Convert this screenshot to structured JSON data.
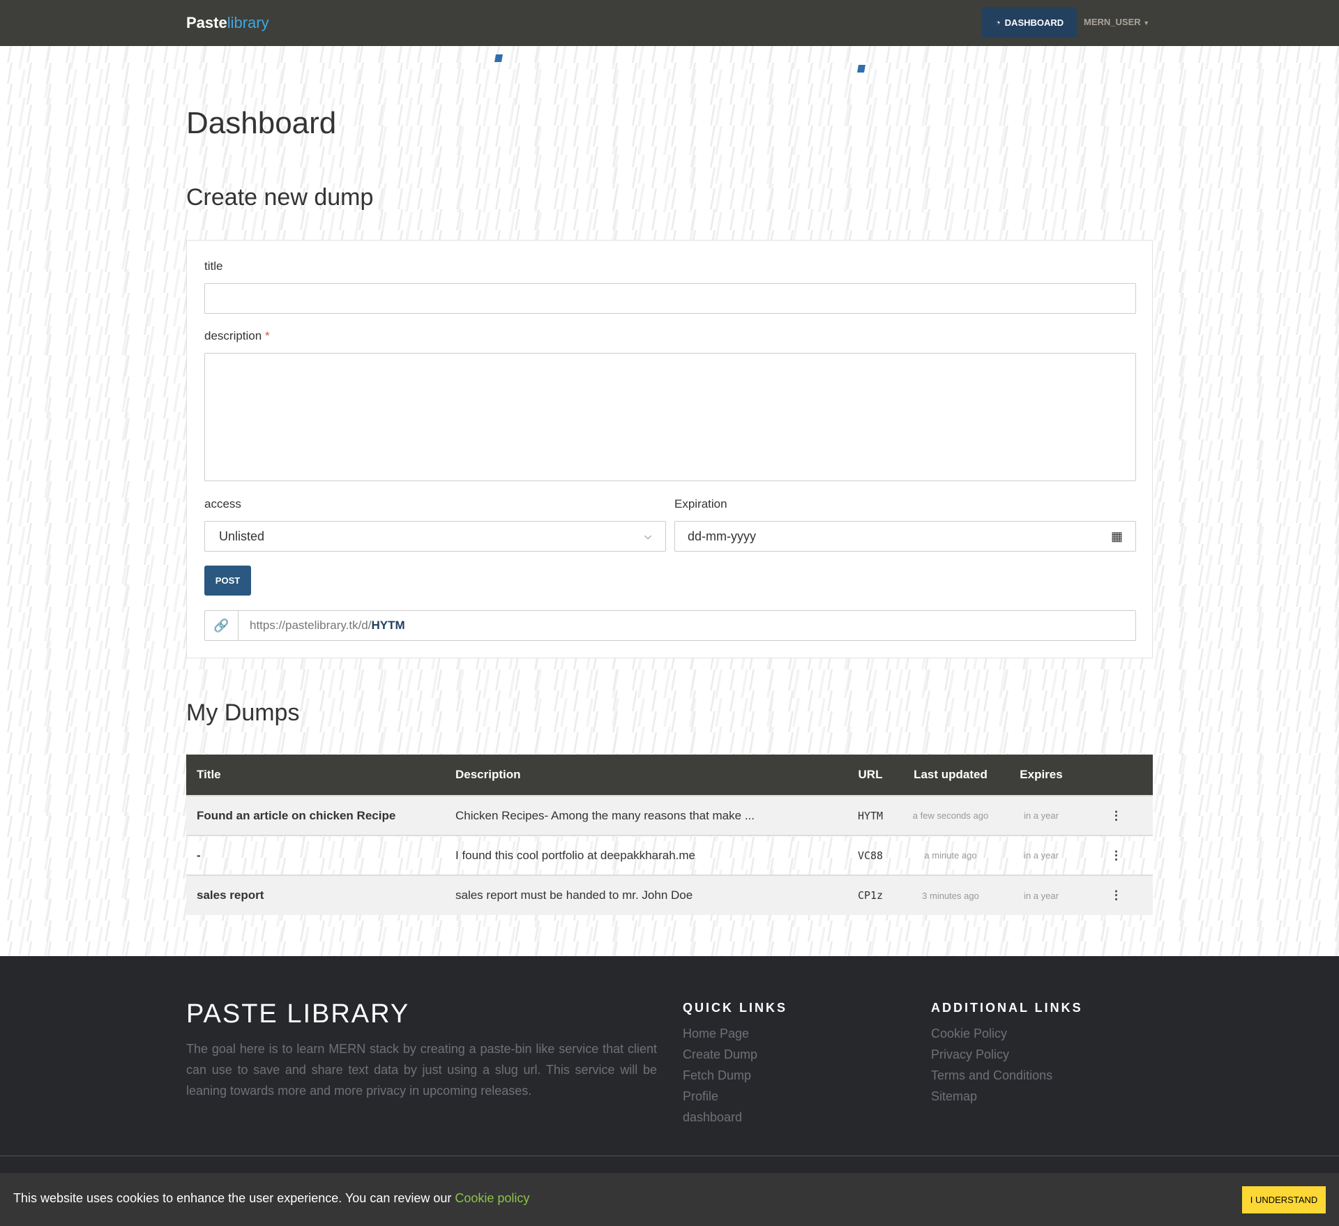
{
  "navbar": {
    "brand_bold": "Paste",
    "brand_light": "library",
    "dashboard": "DASHBOARD",
    "user": "MERN_USER"
  },
  "page": {
    "title": "Dashboard",
    "create_heading": "Create new dump",
    "dumps_heading": "My Dumps"
  },
  "form": {
    "title_label": "title",
    "title_value": "",
    "description_label": "description",
    "required_mark": "*",
    "description_value": "",
    "access_label": "access",
    "access_value": "Unlisted",
    "expiration_label": "Expiration",
    "expiration_placeholder": "dd-mm-yyyy",
    "post_label": "POST",
    "url_prefix": "https://pastelibrary.tk/d/",
    "url_slug": "HYTM"
  },
  "table": {
    "headers": [
      "Title",
      "Description",
      "URL",
      "Last updated",
      "Expires"
    ],
    "rows": [
      {
        "title": "Found an article on chicken Recipe",
        "description": "Chicken Recipes- Among the many reasons that make ...",
        "url": "HYTM",
        "updated": "a few seconds ago",
        "expires": "in a year"
      },
      {
        "title": "-",
        "description": "I found this cool portfolio at deepakkharah.me",
        "url": "VC88",
        "updated": "a minute ago",
        "expires": "in a year"
      },
      {
        "title": "sales report",
        "description": "sales report must be handed to mr. John Doe",
        "url": "CP1z",
        "updated": "3 minutes ago",
        "expires": "in a year"
      }
    ]
  },
  "footer": {
    "title": "PASTE LIBRARY",
    "description": "The goal here is to learn MERN stack by creating a paste-bin like service that client can use to save and share text data by just using a slug url. This service will be leaning towards more and more privacy in upcoming releases.",
    "quick_heading": "QUICK LINKS",
    "quick_links": [
      "Home Page",
      "Create Dump",
      "Fetch Dump",
      "Profile",
      "dashboard"
    ],
    "additional_heading": "ADDITIONAL LINKS",
    "additional_links": [
      "Cookie Policy",
      "Privacy Policy",
      "Terms and Conditions",
      "Sitemap"
    ]
  },
  "cookie": {
    "text": "This website uses cookies to enhance the user experience. You can review our ",
    "link": "Cookie policy",
    "button": "I UNDERSTAND"
  }
}
